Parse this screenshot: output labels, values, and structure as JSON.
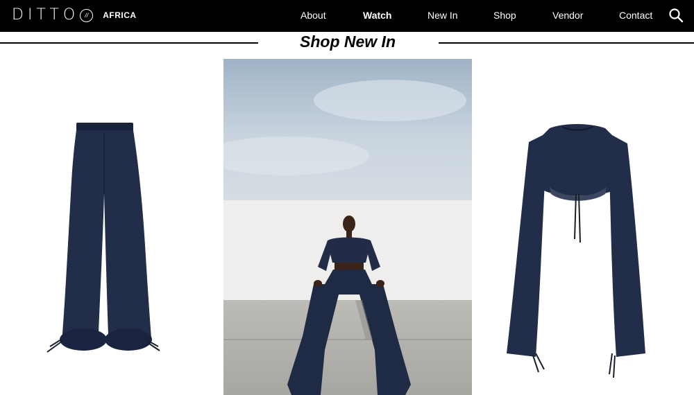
{
  "brand": {
    "logo_text": "DITTO",
    "logo_mark": "//",
    "logo_sub": "AFRICA"
  },
  "nav": {
    "items": [
      {
        "label": "About",
        "active": false
      },
      {
        "label": "Watch",
        "active": true
      },
      {
        "label": "New In",
        "active": false
      },
      {
        "label": "Shop",
        "active": false
      },
      {
        "label": "Vendor",
        "active": false
      },
      {
        "label": "Contact",
        "active": false
      }
    ],
    "search_icon": "search-icon"
  },
  "section": {
    "title": "Shop New In"
  },
  "colors": {
    "nav_bg": "#000000",
    "nav_text": "#ffffff",
    "denim": "#1f2a44",
    "sky": "#c5d1dd",
    "wall": "#efeeec",
    "concrete": "#b4b2ad"
  }
}
